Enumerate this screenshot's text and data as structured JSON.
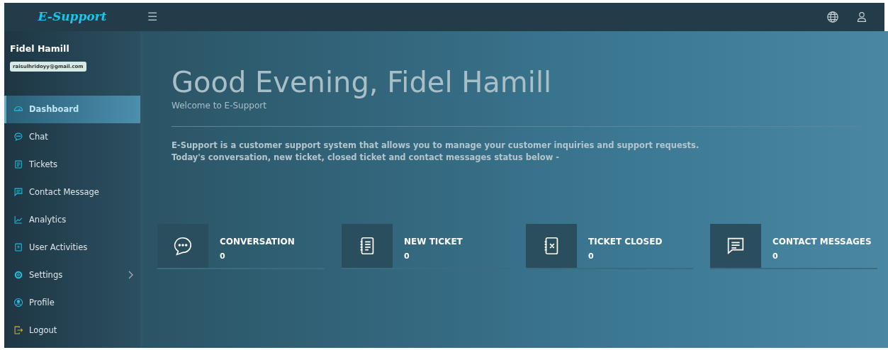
{
  "header": {
    "logo": "E-Support",
    "menu_toggle": "☰"
  },
  "sidebar": {
    "user_name": "Fidel Hamill",
    "email": "raisulhridoyy@gmail.com",
    "items": [
      {
        "label": "Dashboard",
        "selected": true,
        "submenu": false
      },
      {
        "label": "Chat",
        "selected": false,
        "submenu": false
      },
      {
        "label": "Tickets",
        "selected": false,
        "submenu": false
      },
      {
        "label": "Contact Message",
        "selected": false,
        "submenu": false
      },
      {
        "label": "Analytics",
        "selected": false,
        "submenu": false
      },
      {
        "label": "User Activities",
        "selected": false,
        "submenu": false
      },
      {
        "label": "Settings",
        "selected": false,
        "submenu": true
      },
      {
        "label": "Profile",
        "selected": false,
        "submenu": false
      },
      {
        "label": "Logout",
        "selected": false,
        "submenu": false
      }
    ]
  },
  "main": {
    "greeting": "Good Evening, Fidel Hamill",
    "subtitle": "Welcome to E-Support",
    "description": [
      "E-Support is a customer support system that allows you to manage your customer inquiries and support requests.",
      "Today's conversation, new ticket, closed ticket and contact messages status below -"
    ],
    "stats": [
      {
        "title": "CONVERSATION",
        "value": "0"
      },
      {
        "title": "NEW TICKET",
        "value": "0"
      },
      {
        "title": "TICKET CLOSED",
        "value": "0"
      },
      {
        "title": "CONTACT MESSAGES",
        "value": "0"
      }
    ]
  }
}
